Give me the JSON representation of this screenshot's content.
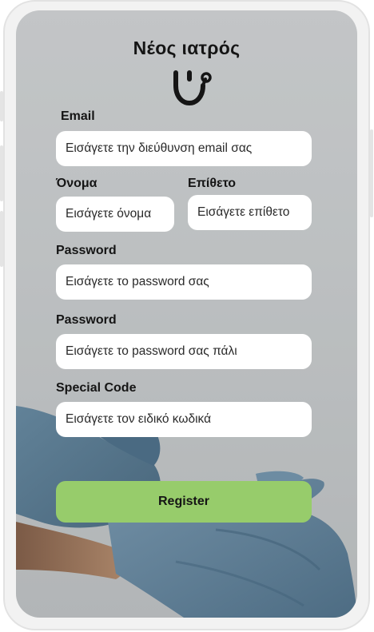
{
  "header": {
    "title": "Νέος ιατρός",
    "icon": "stethoscope-icon"
  },
  "form": {
    "email": {
      "label": "Email",
      "placeholder": "Εισάγετε την διεύθυνση email σας"
    },
    "first_name": {
      "label": "Όνομα",
      "placeholder": "Εισάγετε όνομα"
    },
    "last_name": {
      "label": "Επίθετο",
      "placeholder": "Εισάγετε επίθετο"
    },
    "password": {
      "label": "Password",
      "placeholder": "Εισάγετε το password σας"
    },
    "password_confirm": {
      "label": "Password",
      "placeholder": "Εισάγετε το password σας πάλι"
    },
    "special_code": {
      "label": "Special Code",
      "placeholder": "Εισάγετε τον ειδικό κωδικά"
    },
    "register_label": "Register"
  },
  "colors": {
    "accent": "#97cc6b",
    "field_bg": "#ffffff",
    "text": "#151515"
  }
}
